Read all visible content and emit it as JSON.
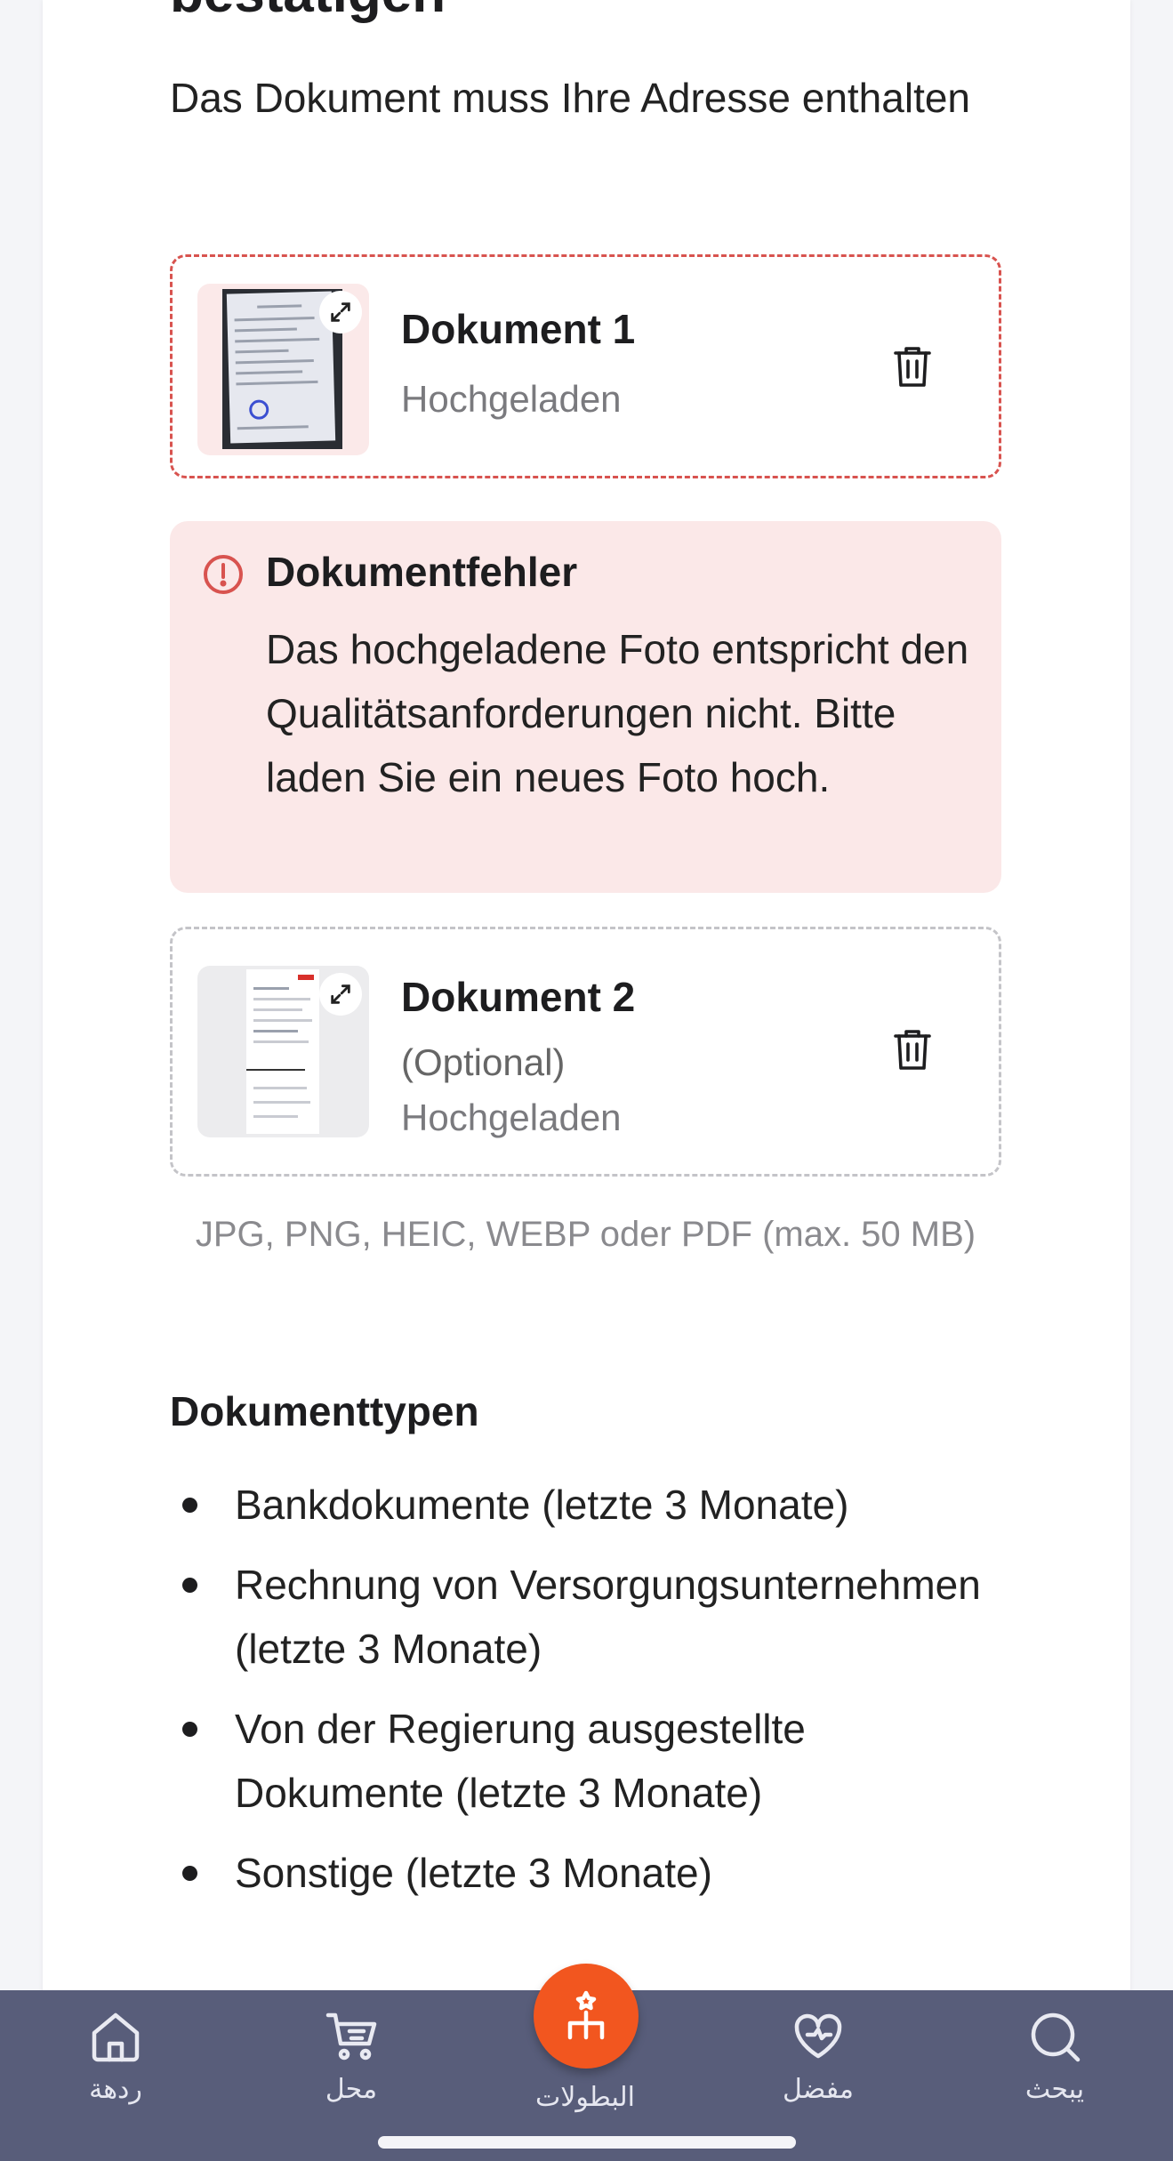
{
  "header": {
    "title_partial": "bestätigen",
    "subtitle": "Das Dokument muss Ihre Adresse enthalten"
  },
  "documents": [
    {
      "title": "Dokument 1",
      "optional_label": "",
      "status": "Hochgeladen",
      "state": "error",
      "border_color": "#d8534f"
    },
    {
      "title": "Dokument 2",
      "optional_label": "(Optional)",
      "status": "Hochgeladen",
      "state": "ok",
      "border_color": "#c4c4c8"
    }
  ],
  "error": {
    "title": "Dokumentfehler",
    "message": "Das hochgeladene Foto entspricht den Qualitätsanforderungen nicht. Bitte laden Sie ein neues Foto hoch.",
    "color": "#d8534f",
    "background": "#fbe8e8"
  },
  "upload": {
    "formats_note": "JPG, PNG, HEIC, WEBP oder PDF (max. 50 MB)"
  },
  "document_types": {
    "title": "Dokumenttypen",
    "items": [
      "Bankdokumente (letzte 3 Monate)",
      "Rechnung von Versorgungsunternehmen (letzte 3 Monate)",
      "Von der Regierung ausgestellte Dokumente (letzte 3 Monate)",
      "Sonstige (letzte 3 Monate)"
    ]
  },
  "bottom_nav": {
    "background": "#585d7a",
    "accent": "#f2561f",
    "items": [
      {
        "label": "ردهة",
        "icon": "home-icon"
      },
      {
        "label": "محل",
        "icon": "cart-icon"
      },
      {
        "label": "البطولات",
        "icon": "tournament-icon"
      },
      {
        "label": "مفضل",
        "icon": "favorite-icon"
      },
      {
        "label": "يبحث",
        "icon": "search-icon"
      }
    ]
  }
}
